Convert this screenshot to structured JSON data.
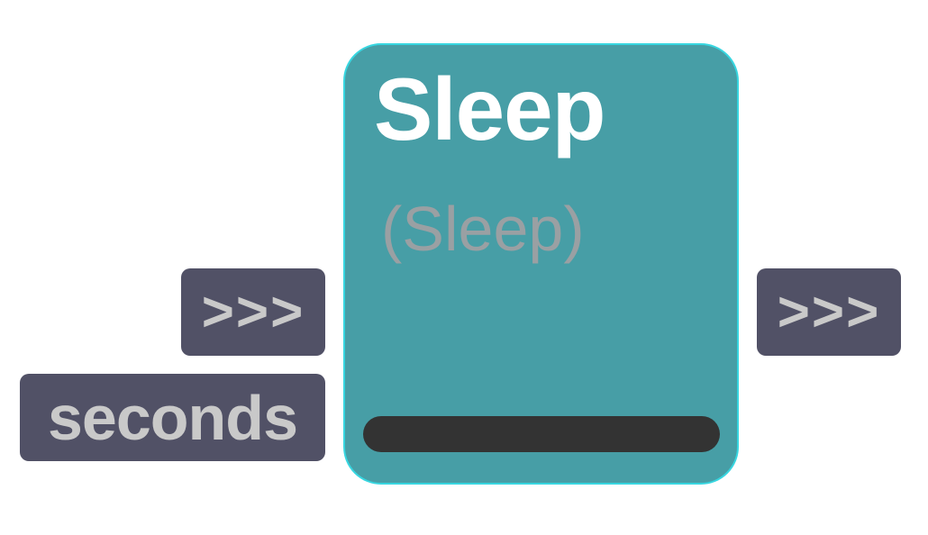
{
  "node": {
    "title": "Sleep",
    "subtitle": "(Sleep)",
    "colors": {
      "background": "#479ea6",
      "border": "#37d6e0",
      "title": "#ffffff",
      "subtitle": "#9aa0a3",
      "progress_track": "#333333"
    }
  },
  "inputs": {
    "exec_label": ">>>",
    "param_label": "seconds"
  },
  "outputs": {
    "exec_label": ">>>"
  },
  "pin_colors": {
    "background": "#515166",
    "text": "#c9c9c9"
  }
}
